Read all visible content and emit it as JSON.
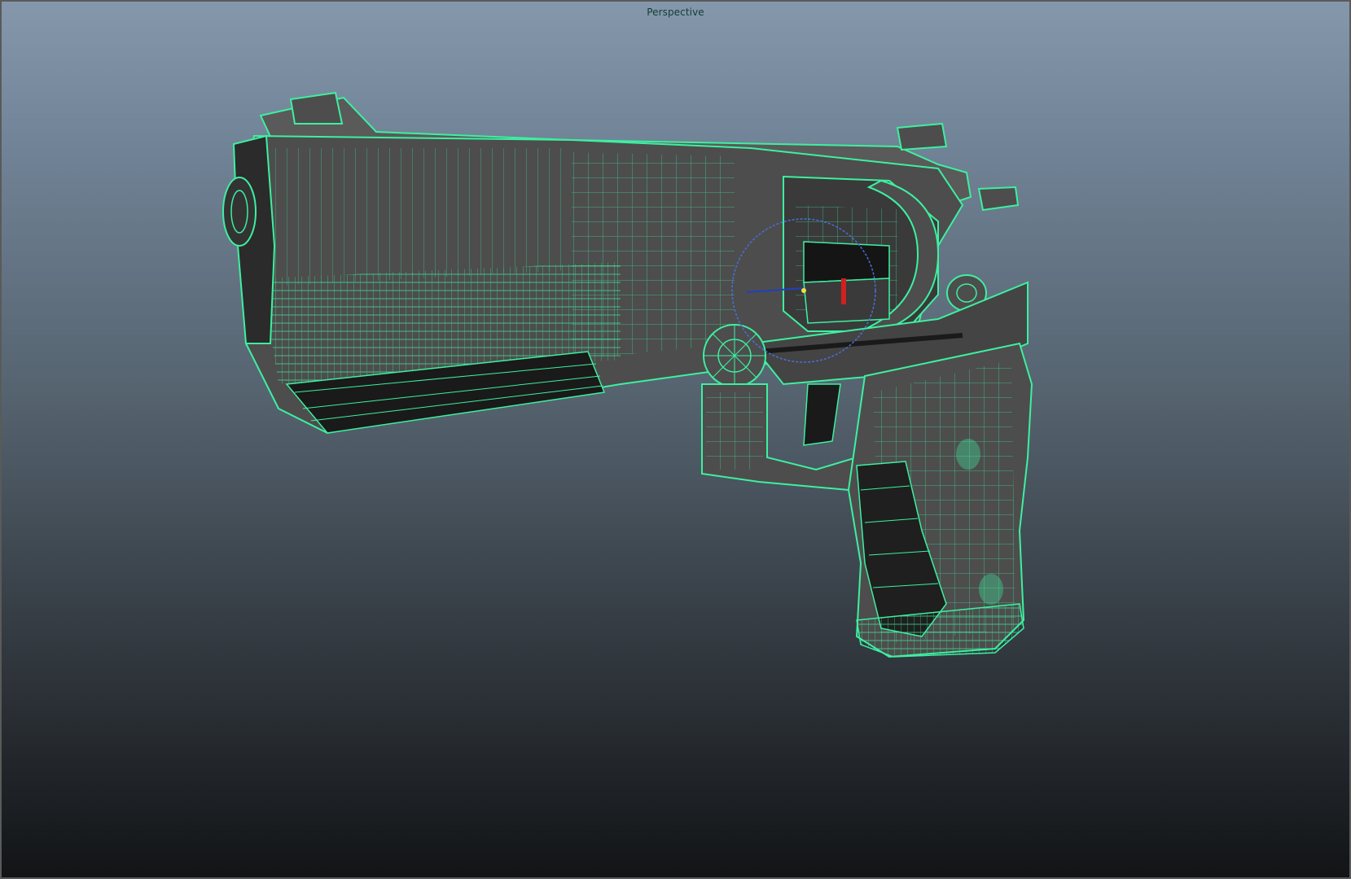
{
  "viewport": {
    "camera_label": "Perspective"
  },
  "model": {
    "icon": "wireframe-pistol",
    "wire_color": "#3df0a0",
    "surface_color": "#4d4d4d",
    "shadow_color": "#1a1a1a"
  },
  "manipulator": {
    "icon": "rotate-manipulator",
    "ring_color": "#4a6fd8",
    "axis_y_color": "#d02020",
    "axis_x_color": "#2040c0"
  }
}
